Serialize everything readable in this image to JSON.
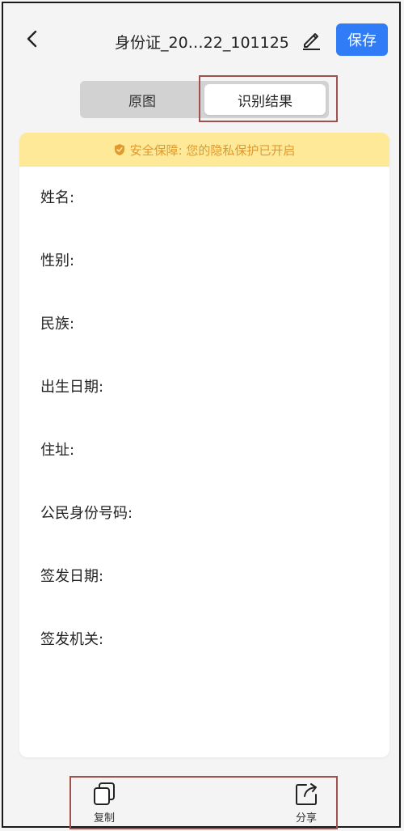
{
  "header": {
    "title": "身份证_20…22_101125",
    "save_label": "保存"
  },
  "tabs": {
    "original_label": "原图",
    "result_label": "识别结果"
  },
  "banner": {
    "text": "安全保障: 您的隐私保护已开启"
  },
  "fields": [
    {
      "label": "姓名:"
    },
    {
      "label": "性别:"
    },
    {
      "label": "民族:"
    },
    {
      "label": "出生日期:"
    },
    {
      "label": "住址:"
    },
    {
      "label": "公民身份号码:"
    },
    {
      "label": "签发日期:"
    },
    {
      "label": "签发机关:"
    }
  ],
  "toolbar": {
    "copy_label": "复制",
    "share_label": "分享"
  },
  "colors": {
    "accent": "#2f7cf6",
    "banner_bg": "#fde997",
    "banner_text": "#e1992f",
    "highlight": "#a0524a"
  },
  "icons": {
    "back": "chevron-left-icon",
    "edit": "pencil-icon",
    "shield": "shield-check-icon",
    "copy": "copy-icon",
    "share": "share-icon"
  }
}
